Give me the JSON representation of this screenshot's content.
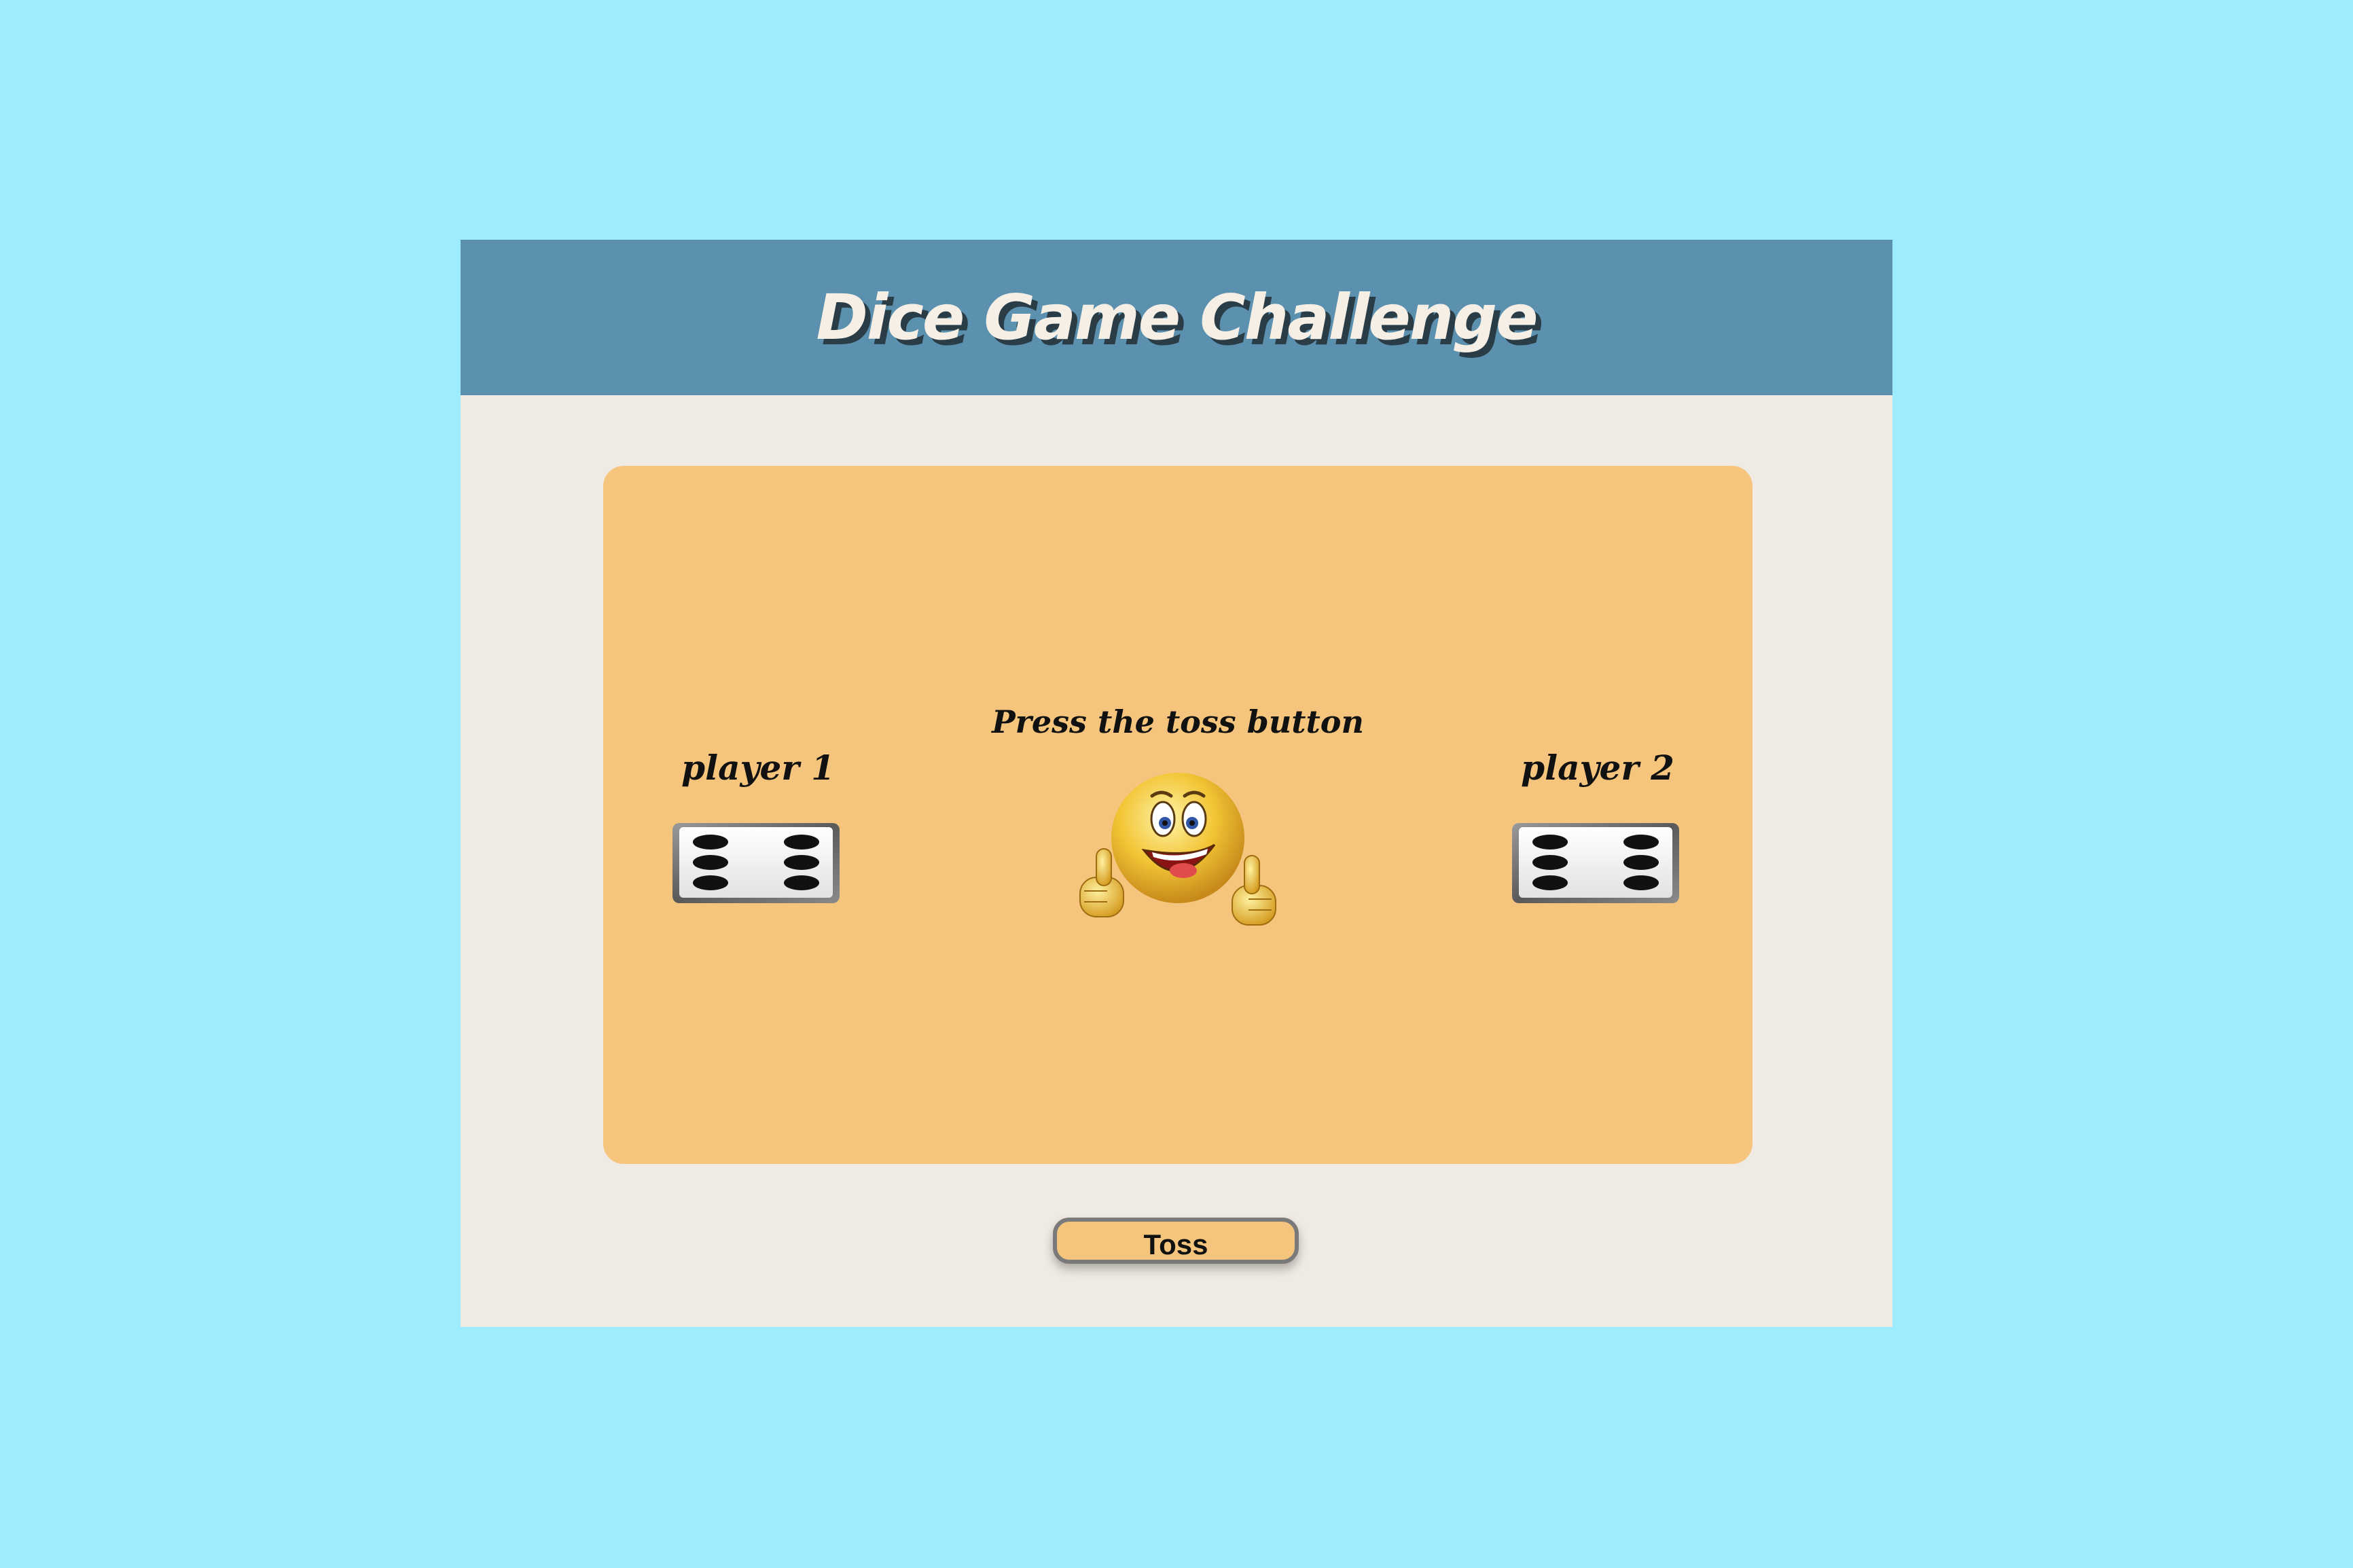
{
  "game": {
    "title": "Dice Game Challenge",
    "status_text": "Press the toss button",
    "players": [
      {
        "label": "player 1",
        "die_value": 6
      },
      {
        "label": "player 2",
        "die_value": 6
      }
    ],
    "center_icon": "thumbs-up-smiley-icon",
    "toss_label": "Toss"
  },
  "colors": {
    "page_background": "#9eecfe",
    "header": "#5b91af",
    "title_text": "#f6efe6",
    "window_background": "#f0eae4",
    "board": "#f5c57d",
    "button": "#f5c57d"
  }
}
